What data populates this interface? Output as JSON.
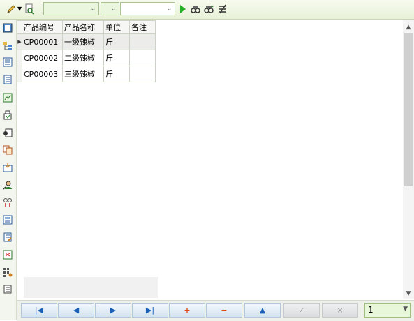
{
  "toolbar": {
    "combo1_value": "",
    "combo2_value": "",
    "combo3_value": ""
  },
  "grid": {
    "columns": [
      "产品编号",
      "产品名称",
      "单位",
      "备注"
    ],
    "rows": [
      {
        "code": "CP00001",
        "name": "一级辣椒",
        "unit": "斤",
        "note": ""
      },
      {
        "code": "CP00002",
        "name": "二级辣椒",
        "unit": "斤",
        "note": ""
      },
      {
        "code": "CP00003",
        "name": "三级辣椒",
        "unit": "斤",
        "note": ""
      }
    ]
  },
  "navigator": {
    "page_value": "1"
  }
}
